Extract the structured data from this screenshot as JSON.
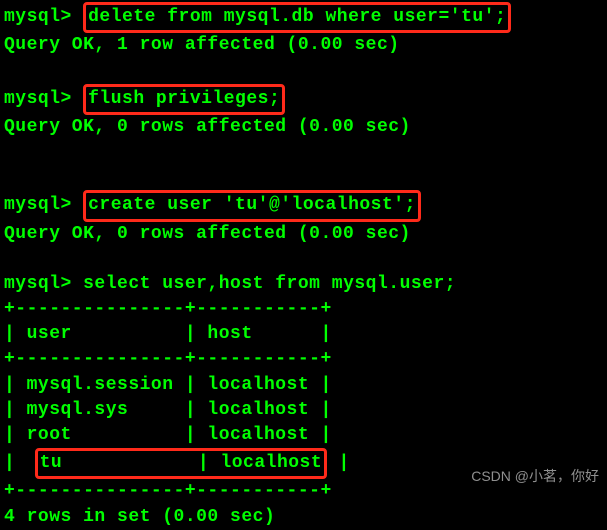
{
  "prompt": "mysql> ",
  "cmd1": "delete from mysql.db where user='tu';",
  "res1": "Query OK, 1 row affected (0.00 sec)",
  "cmd2": "flush privileges;",
  "res2": "Query OK, 0 rows affected (0.00 sec)",
  "cmd3": "create user 'tu'@'localhost';",
  "res3": "Query OK, 0 rows affected (0.00 sec)",
  "cmd4": "select user,host from mysql.user;",
  "table_border_top": "+---------------+-----------+",
  "table_header": "| user          | host      |",
  "table_border_mid": "+---------------+-----------+",
  "table_row1": "| mysql.session | localhost |",
  "table_row2": "| mysql.sys     | localhost |",
  "table_row3": "| root          | localhost |",
  "table_row4_inner": "tu            | localhost",
  "table_row4_leading": "| ",
  "table_row4_trailing": " |",
  "table_border_bot": "+---------------+-----------+",
  "res4": "4 rows in set (0.00 sec)",
  "watermark": "CSDN @小茗，你好",
  "chart_data": {
    "type": "table",
    "title": "select user,host from mysql.user;",
    "columns": [
      "user",
      "host"
    ],
    "rows": [
      [
        "mysql.session",
        "localhost"
      ],
      [
        "mysql.sys",
        "localhost"
      ],
      [
        "root",
        "localhost"
      ],
      [
        "tu",
        "localhost"
      ]
    ]
  }
}
